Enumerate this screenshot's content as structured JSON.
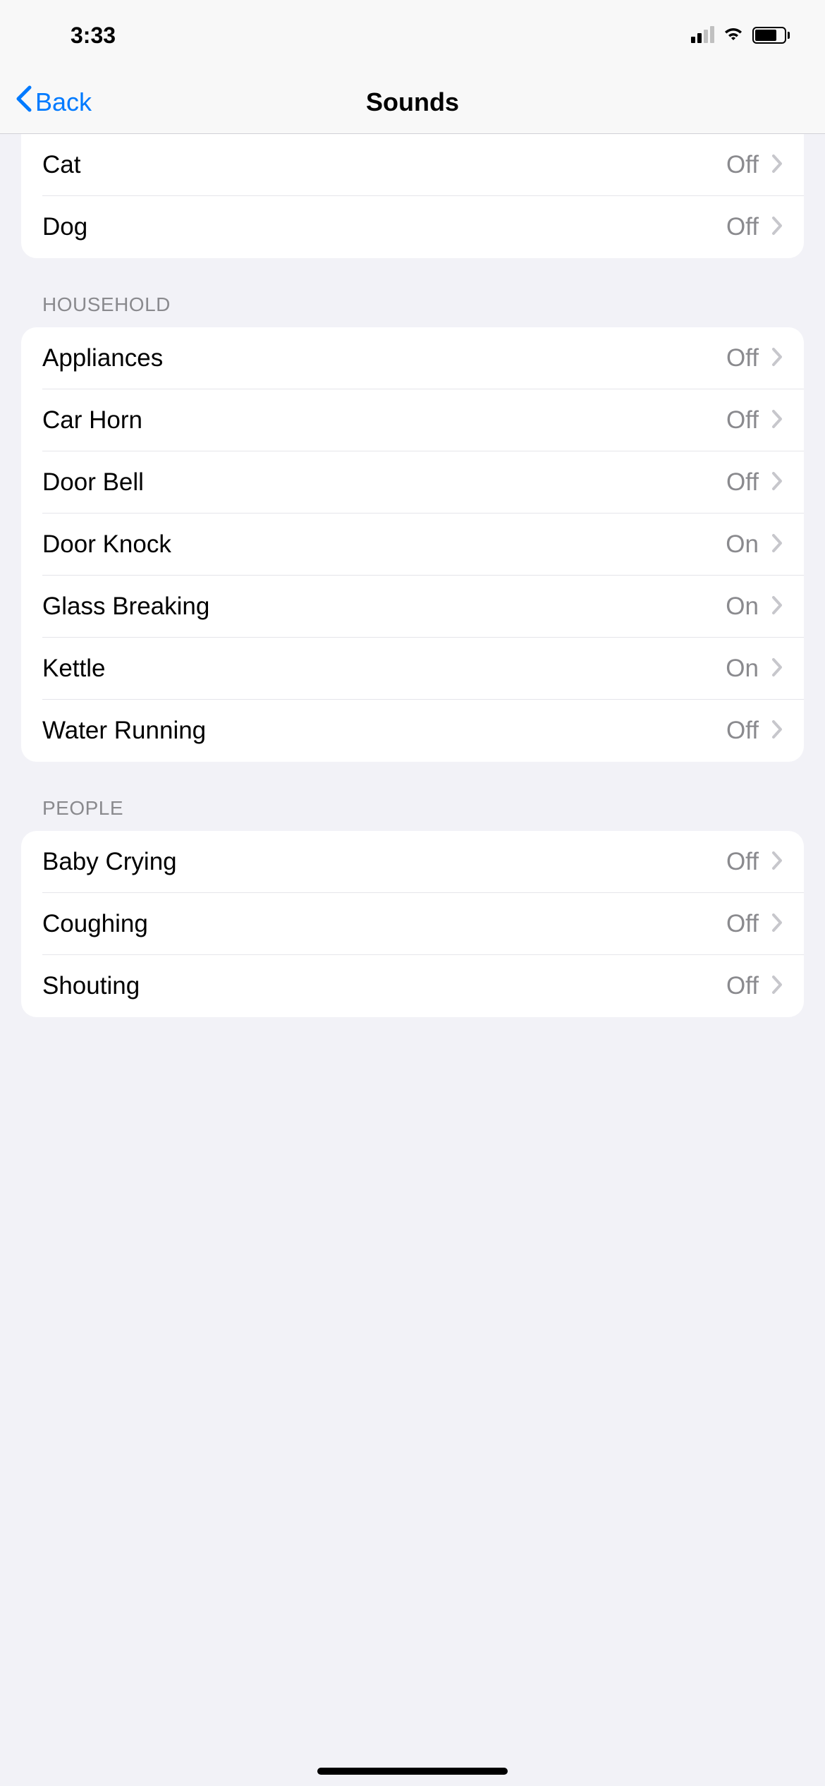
{
  "status_bar": {
    "time": "3:33"
  },
  "nav": {
    "back_label": "Back",
    "title": "Sounds"
  },
  "sections": {
    "animals": {
      "items": [
        {
          "label": "Cat",
          "value": "Off"
        },
        {
          "label": "Dog",
          "value": "Off"
        }
      ]
    },
    "household": {
      "header": "Household",
      "items": [
        {
          "label": "Appliances",
          "value": "Off"
        },
        {
          "label": "Car Horn",
          "value": "Off"
        },
        {
          "label": "Door Bell",
          "value": "Off"
        },
        {
          "label": "Door Knock",
          "value": "On"
        },
        {
          "label": "Glass Breaking",
          "value": "On"
        },
        {
          "label": "Kettle",
          "value": "On"
        },
        {
          "label": "Water Running",
          "value": "Off"
        }
      ]
    },
    "people": {
      "header": "People",
      "items": [
        {
          "label": "Baby Crying",
          "value": "Off"
        },
        {
          "label": "Coughing",
          "value": "Off"
        },
        {
          "label": "Shouting",
          "value": "Off"
        }
      ]
    }
  }
}
